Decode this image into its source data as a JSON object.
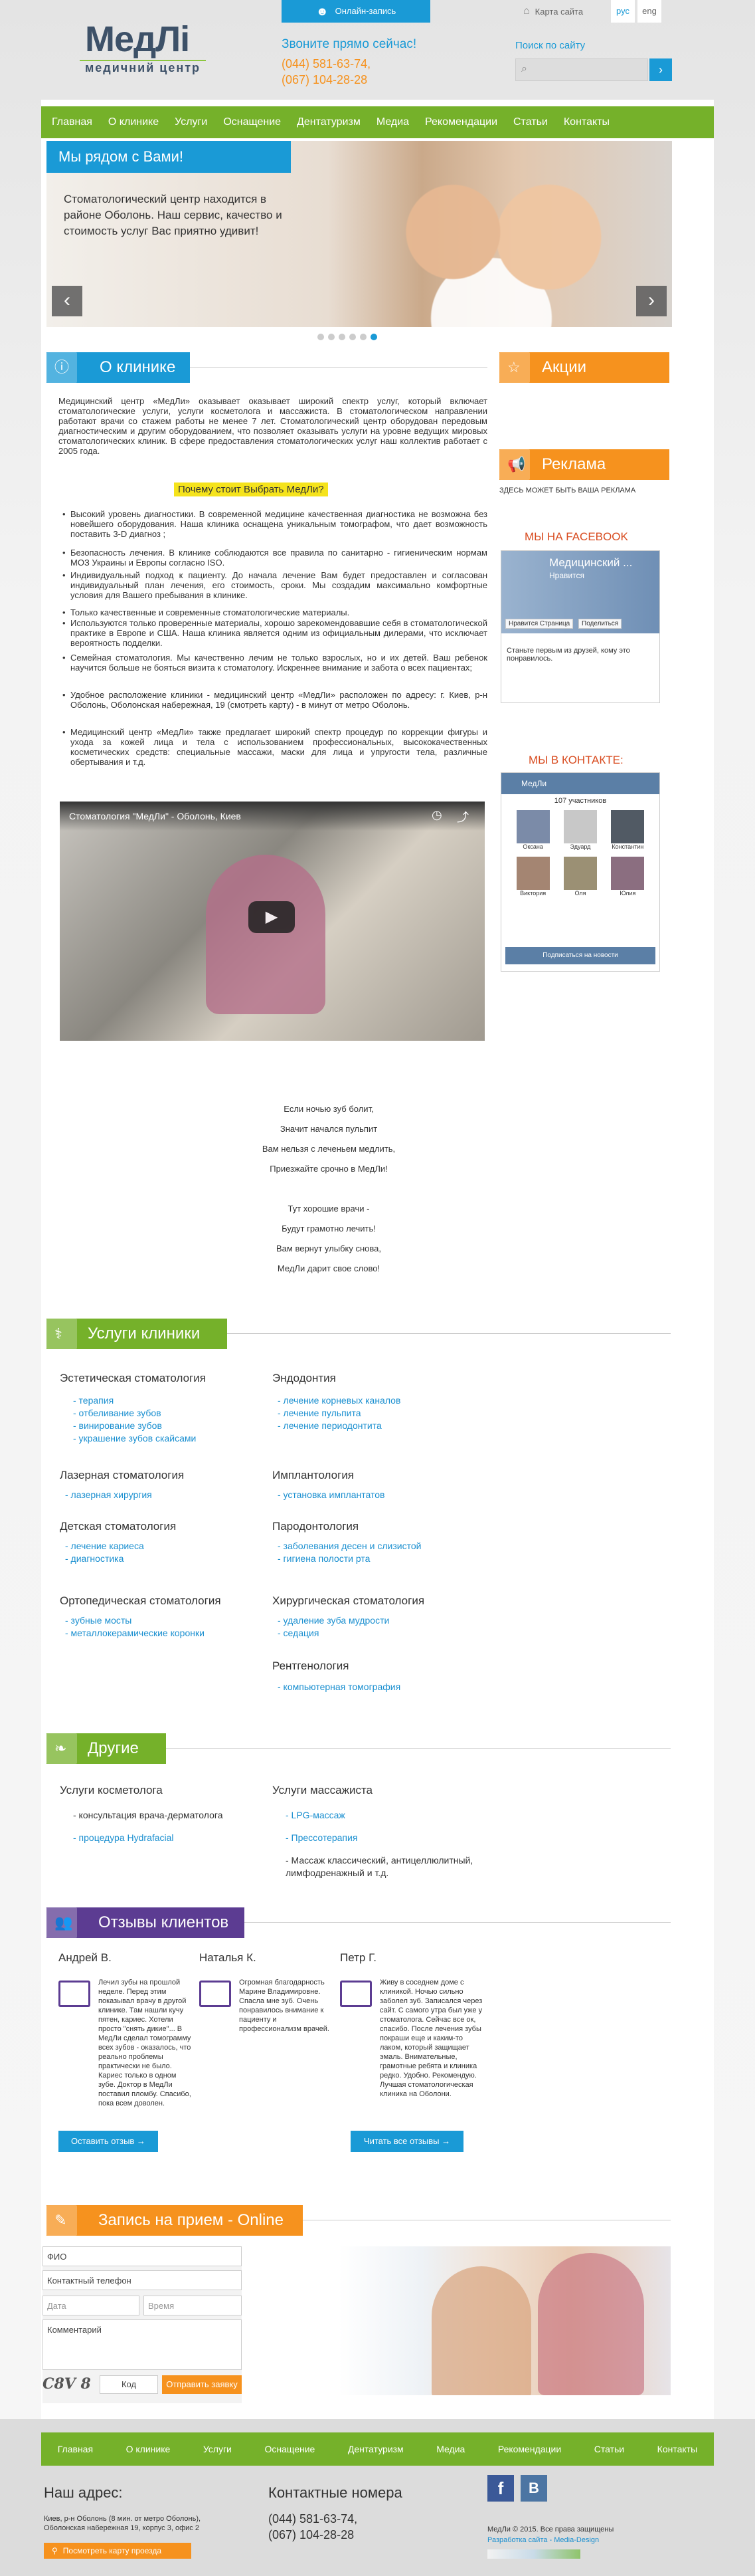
{
  "header": {
    "logo_title": "МедЛі",
    "logo_subtitle": "медичний центр",
    "online_btn": "Онлайн-запись",
    "call_label": "Звоните прямо сейчас!",
    "phone1": "(044) 581-63-74,",
    "phone2": "(067) 104-28-28",
    "sitemap": "Карта сайта",
    "lang_ru": "рус",
    "lang_en": "eng",
    "search_label": "Поиск по сайту"
  },
  "menu": [
    "Главная",
    "О клинике",
    "Услуги",
    "Оснащение",
    "Дентатуризм",
    "Медиа",
    "Рекомендации",
    "Статьи",
    "Контакты"
  ],
  "slider": {
    "title": "Мы рядом с Вами!",
    "text": "Стоматологический центр находится в районе Оболонь. Наш сервис, качество и стоимость услуг Вас приятно удивит!",
    "dots": 6,
    "active": 5
  },
  "about": {
    "title": "О клинике",
    "p1": "Медицинский центр «МедЛи» оказывает оказывает  широкий спектр услуг, который включает стоматологические услуги, услуги косметолога и массажиста. В стоматологическом направлении работают врачи со стажем работы не менее 7 лет. Стоматологический центр оборудован передовым диагностическим и другим оборудованием, что позволяет оказывать услуги на уровне ведущих мировых стоматологических клиник. В сфере предоставления стоматологических услуг наш коллектив работает с 2005 года.",
    "why": "Почему стоит Выбрать МедЛи?",
    "bullets": [
      "Высокий уровень диагностики. В современной медицине качественная диагностика не возможна без новейшего оборудования. Наша клиника оснащена уникальным томографом, что дает возможность поставить 3-D диагноз ;",
      "Безопасность лечения.  В клинике соблюдаются все правила по санитарно - гигиеническим нормам МОЗ Украины и Европы согласно ISO.",
      "Индивидуальный подход к пациенту. До начала лечение  Вам будет предоставлен и согласован индивидуальный план лечения, его стоимость, сроки. Мы создадим максимально комфортные условия для Вашего пребывания в клинике.",
      "Только качественные и современные стоматологические материалы.",
      "Используются только проверенные материалы, хорошо зарекомендовавшие себя в стоматологической практике в Европе и США. Наша клиника является одним из официальным дилерами, что исключает вероятность подделки.",
      "Семейная стоматология. Мы качественно лечим не только взрослых, но и их детей. Ваш ребенок научится больше не бояться визита к стоматологу. Искреннее внимание и забота о всех пациентах;",
      "Удобное расположение клиники - медицинский центр «МедЛи» расположен по адресу: г. Киев, р-н Оболонь, Оболонская набережная, 19 (смотреть карту) - в минут от метро Оболонь.",
      "Медицинский центр «МедЛи» также предлагает широкий спектр процедур по коррекции фигуры и ухода за кожей лица и тела с использованием профессиональных, высококачественных косметических средств: специальные массажи, маски для лица и упругости тела, различные обертывания и т.д."
    ],
    "video_title": "Стоматология \"МедЛи\" - Оболонь, Киев",
    "poem": [
      "Если ночью зуб болит,",
      "Значит начался пульпит",
      "Вам нельзя с леченьем медлить,",
      "Приезжайте срочно в МедЛи!",
      "",
      "Тут хорошие врачи -",
      "Будут грамотно лечить!",
      "Вам вернут улыбку снова,",
      "МедЛи дарит свое слово!"
    ]
  },
  "sidebar": {
    "promo": "Акции",
    "ads": "Реклама",
    "ads_text": "ЗДЕСЬ МОЖЕТ БЫТЬ ВАША РЕКЛАМА",
    "fb_title": "МЫ НА FACEBOOK",
    "fb_page": "Медицинский ...",
    "fb_sub": "Нравится",
    "fb_like": "Нравится Страница",
    "fb_share": "Поделиться",
    "fb_text": "Станьте первым из друзей, кому это понравилось.",
    "vk_title": "МЫ В КОНТАКТЕ:",
    "vk_group": "МедЛи",
    "vk_members": "107 участников",
    "vk_people": [
      "Оксана",
      "Эдуард",
      "Константин",
      "Виктория",
      "Оля",
      "Юлия"
    ],
    "vk_btn": "Подписаться на новости"
  },
  "services": {
    "title": "Услуги клиники",
    "cols": [
      [
        {
          "h": "Эстетическая стоматология",
          "items": [
            "- терапия",
            "- отбеливание зубов",
            "- винирование зубов",
            "- украшение зубов скайсами"
          ]
        },
        {
          "h": "Лазерная стоматология",
          "items": [
            "- лазерная хирургия"
          ]
        },
        {
          "h": "Детская стоматология",
          "items": [
            "- лечение кариеса",
            "- диагностика"
          ]
        },
        {
          "h": "Ортопедическая стоматология",
          "items": [
            "- зубные мосты",
            "- металлокерамические коронки"
          ]
        }
      ],
      [
        {
          "h": "Эндодонтия",
          "items": [
            "- лечение корневых каналов",
            "- лечение пульпита",
            "- лечение периодонтита"
          ]
        },
        {
          "h": "Имплантология",
          "items": [
            "- установка имплантатов"
          ]
        },
        {
          "h": "Пародонтология",
          "items": [
            "- заболевания десен и слизистой",
            "- гигиена полости рта"
          ]
        },
        {
          "h": "Хирургическая стоматология",
          "items": [
            "- удаление зуба мудрости",
            "- седация"
          ]
        },
        {
          "h": "Рентгенология",
          "items": [
            "- компьютерная томография"
          ]
        }
      ]
    ]
  },
  "other": {
    "title": "Другие услуги",
    "col1_h": "Услуги косметолога",
    "col1": [
      "- консультация врача-дерматолога",
      "- процедура Hydrafacial"
    ],
    "col2_h": "Услуги массажиста",
    "col2": [
      "- LPG-массаж",
      "- Прессотерапия",
      "- Массаж классический, антицеллюлитный, лимфодренажный и т.д."
    ]
  },
  "reviews": {
    "title": "Отзывы клиентов",
    "items": [
      {
        "name": "Андрей В.",
        "text": "Лечил зубы на прошлой неделе. Перед этим показывал врачу в другой клинике. Там нашли кучу пятен, кариес. Хотели просто \"снять дикие\"... В МедЛи сделал томограмму всех зубов - оказалось, что реально проблемы практически не было. Кариес только в одном зубе. Доктор в МедЛи поставил пломбу. Спасибо, пока всем доволен."
      },
      {
        "name": "Наталья К.",
        "text": "Огромная благодарность Марине Владимировне. Спасла мне зуб. Очень понравилось внимание к пациенту и профессионализм врачей."
      },
      {
        "name": "Петр Г.",
        "text": "Живу в соседнем доме с клиникой. Ночью сильно заболел зуб. Записался через сайт. С самого утра был уже у стоматолога. Сейчас все ок, спасибо. После лечения зубы покраши еще и каким-то лаком, который защищает эмаль. Внимательные, грамотные ребята и клиника редко. Удобно. Рекомендую. Лучшая стоматологическая клиника на Оболони."
      }
    ],
    "leave_btn": "Оставить отзыв →",
    "all_btn": "Читать все отзывы →"
  },
  "booking": {
    "title": "Запись на прием - Online",
    "fio": "ФИО",
    "phone": "Контактный телефон",
    "date": "Дата",
    "time": "Время",
    "comment": "Комментарий",
    "captcha": "C8V 8",
    "code": "Код",
    "submit": "Отправить заявку"
  },
  "footer": {
    "menu": [
      "Главная",
      "О клинике",
      "Услуги",
      "Оснащение",
      "Дентатуризм",
      "Медиа",
      "Рекомендации",
      "Статьи",
      "Контакты"
    ],
    "addr_title": "Наш адрес:",
    "addr1": "Киев, р-н Оболонь (8 мин. от метро Оболонь),",
    "addr2": "Оболонская набережная 19, корпус 3, офис 2",
    "map_btn": "Посмотреть карту проезда",
    "contacts_title": "Контактные номера",
    "phone1": "(044) 581-63-74,",
    "phone2": "(067) 104-28-28",
    "copy": "МедЛи © 2015. Все права защищены",
    "dev": "Разработка сайта - Media-Design"
  },
  "colors": {
    "green": "#75b12a",
    "orange": "#f6921e",
    "blue": "#1a9ad6",
    "purple": "#5c3c92"
  }
}
